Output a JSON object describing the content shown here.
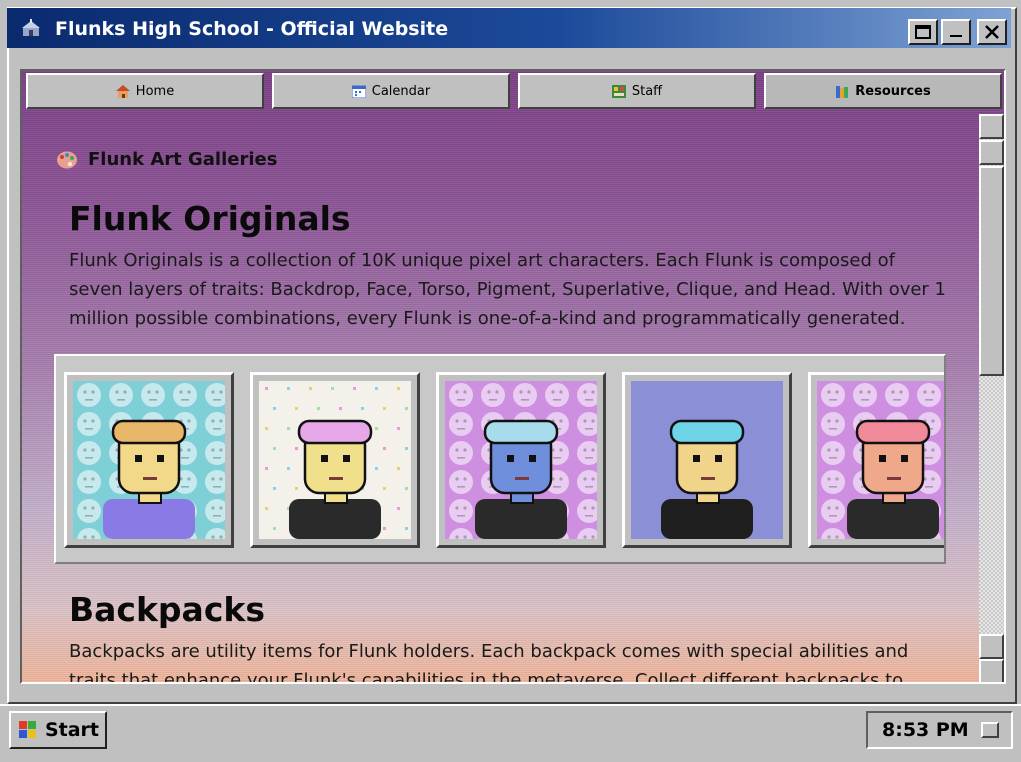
{
  "window": {
    "title": "Flunks High School - Official Website"
  },
  "nav": {
    "items": [
      {
        "label": "Home",
        "icon": "house-icon"
      },
      {
        "label": "Calendar",
        "icon": "calendar-icon"
      },
      {
        "label": "Staff",
        "icon": "staff-icon"
      },
      {
        "label": "Resources",
        "icon": "books-icon",
        "active": true
      }
    ]
  },
  "page": {
    "section_label": "Flunk Art Galleries",
    "originals": {
      "heading": "Flunk Originals",
      "description": "Flunk Originals is a collection of 10K unique pixel art characters. Each Flunk is composed of seven layers of traits: Backdrop, Face, Torso, Pigment, Superlative, Clique, and Head. With over 1 million possible combinations, every Flunk is one-of-a-kind and programmatically generated."
    },
    "gallery": [
      {
        "name": "flunk-1",
        "bg": "#7ecfd6",
        "pattern": "smiley",
        "skin": "#f2d98a",
        "hair": "#e8b76a",
        "outfit": "#8a7ae6"
      },
      {
        "name": "flunk-2",
        "bg": "#f4f0ea",
        "pattern": "sparkle",
        "skin": "#f0e08c",
        "hair": "#e6a8e8",
        "outfit": "#2a2a2a"
      },
      {
        "name": "flunk-3",
        "bg": "#cf8fe0",
        "pattern": "smiley",
        "skin": "#6f8fdc",
        "hair": "#a8dcec",
        "outfit": "#2a2a2a"
      },
      {
        "name": "flunk-4",
        "bg": "#8b8fd6",
        "pattern": "none",
        "skin": "#f0d48a",
        "hair": "#6fd4e8",
        "outfit": "#1e1e1e"
      },
      {
        "name": "flunk-5",
        "bg": "#cf8fe0",
        "pattern": "smiley",
        "skin": "#f0a88a",
        "hair": "#f08a9a",
        "outfit": "#2a2a2a"
      }
    ],
    "backpacks": {
      "heading": "Backpacks",
      "description": "Backpacks are utility items for Flunk holders. Each backpack comes with special abilities and traits that enhance your Flunk's capabilities in the metaverse. Collect different backpacks to unlock new"
    }
  },
  "taskbar": {
    "start_label": "Start",
    "clock": "8:53 PM"
  }
}
